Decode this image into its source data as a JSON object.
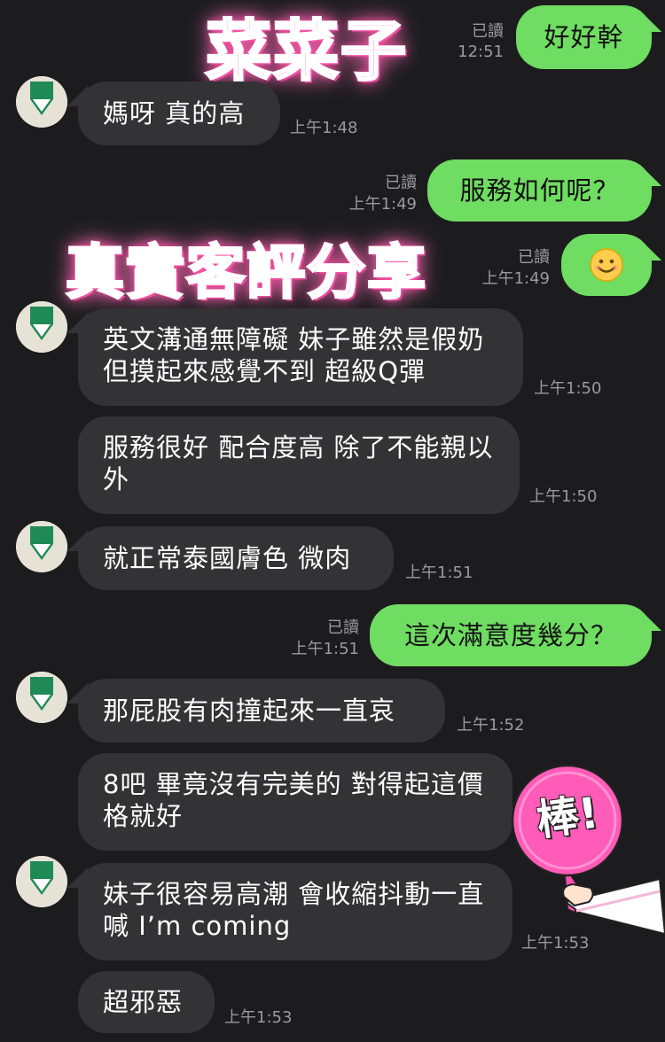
{
  "overlays": {
    "title_top": "菜菜子",
    "title_mid": "真實客評分享",
    "sticker_text": "棒!"
  },
  "messages": [
    {
      "side": "out",
      "text": "好好幹",
      "read": "已讀",
      "time": "12:51"
    },
    {
      "side": "in",
      "text": "媽呀 真的高",
      "time": "上午1:48"
    },
    {
      "side": "out",
      "text": "服務如何呢？",
      "read": "已讀",
      "time": "上午1:49"
    },
    {
      "side": "out",
      "emoji": "😊",
      "read": "已讀",
      "time": "上午1:49"
    },
    {
      "side": "in",
      "text": "英文溝通無障礙 妹子雖然是假奶 但摸起來感覺不到 超級Q彈",
      "time": "上午1:50"
    },
    {
      "side": "in",
      "text": "服務很好 配合度高 除了不能親以外",
      "time": "上午1:50"
    },
    {
      "side": "in",
      "text": "就正常泰國膚色 微肉",
      "time": "上午1:51"
    },
    {
      "side": "out",
      "text": "這次滿意度幾分？",
      "read": "已讀",
      "time": "上午1:51"
    },
    {
      "side": "in",
      "text": "那屁股有肉撞起來一直哀",
      "time": "上午1:52"
    },
    {
      "side": "in",
      "text": "8吧 畢竟沒有完美的 對得起這價格就好",
      "time": ""
    },
    {
      "side": "in",
      "text": "妹子很容易高潮 會收縮抖動一直喊 I’m coming",
      "time": "上午1:53"
    },
    {
      "side": "in",
      "text": "超邪惡",
      "time": "上午1:53"
    }
  ],
  "colors": {
    "background": "#1c1c1e",
    "incoming_bubble": "#333336",
    "outgoing_bubble": "#6fdc62",
    "timestamp": "#9a9a9e",
    "overlay_pink": "#ff7fbf"
  }
}
